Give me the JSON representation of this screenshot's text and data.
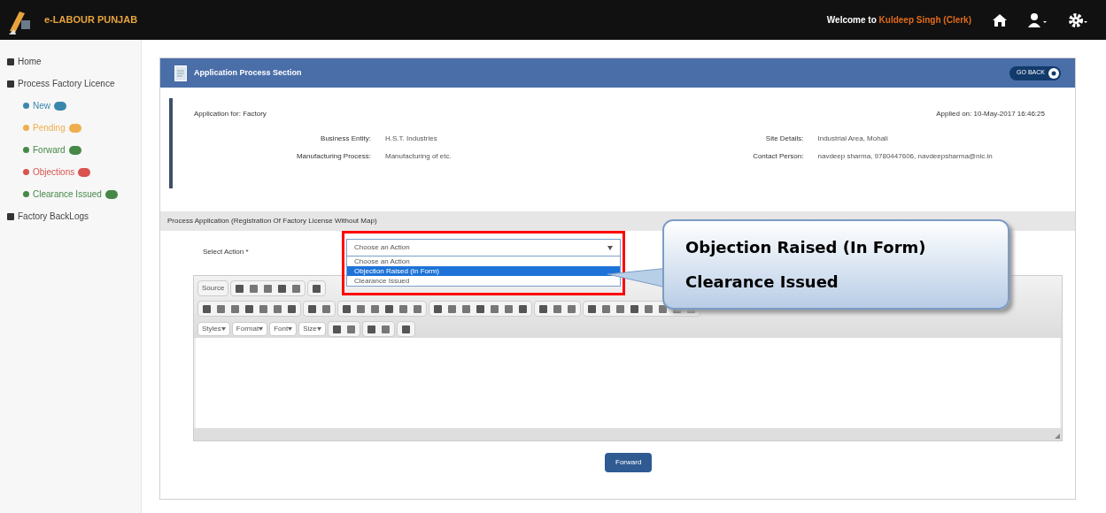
{
  "header": {
    "brand": "e-LABOUR PUNJAB",
    "welcome": "Welcome to",
    "user": "Kuldeep Singh (Clerk)"
  },
  "sidebar": {
    "items": [
      {
        "label": "Home"
      },
      {
        "label": "Process Factory Licence",
        "children": [
          {
            "label": "New",
            "color": "#3a87ad"
          },
          {
            "label": "Pending",
            "color": "#f0ad4e"
          },
          {
            "label": "Forward",
            "color": "#468847"
          },
          {
            "label": "Objections",
            "color": "#d9534f"
          },
          {
            "label": "Clearance Issued",
            "color": "#468847"
          }
        ]
      },
      {
        "label": "Factory BackLogs"
      }
    ]
  },
  "panel": {
    "title": "Application Process Section",
    "back_button": "GO BACK",
    "application_for": "Application for: Factory",
    "applied_on": "Applied on: 10-May-2017 16:46:25",
    "details": [
      {
        "label": "Business Entity:",
        "value": "H.S.T. Industries"
      },
      {
        "label": "Site Details:",
        "value": "Industrial Area, Mohali"
      },
      {
        "label": "Manufacturing Process:",
        "value": "Manufacturing of etc."
      },
      {
        "label": "Contact Person:",
        "value": "navdeep sharma, 9780447606, navdeepsharma@nic.in"
      }
    ],
    "process_title": "Process Application (Registration Of Factory License Without Map)",
    "select_label": "Select Action *",
    "select_value": "Choose an Action",
    "options": [
      {
        "label": "Choose an Action",
        "selected": false
      },
      {
        "label": "Objection Raised (In Form)",
        "selected": true
      },
      {
        "label": "Clearance Issued",
        "selected": false
      }
    ],
    "editor": {
      "source": "Source",
      "dropdowns": [
        "Styles",
        "Format",
        "Font",
        "Size"
      ]
    },
    "submit": "Forward"
  },
  "callout": [
    "Objection Raised (In Form)",
    "Clearance Issued"
  ]
}
